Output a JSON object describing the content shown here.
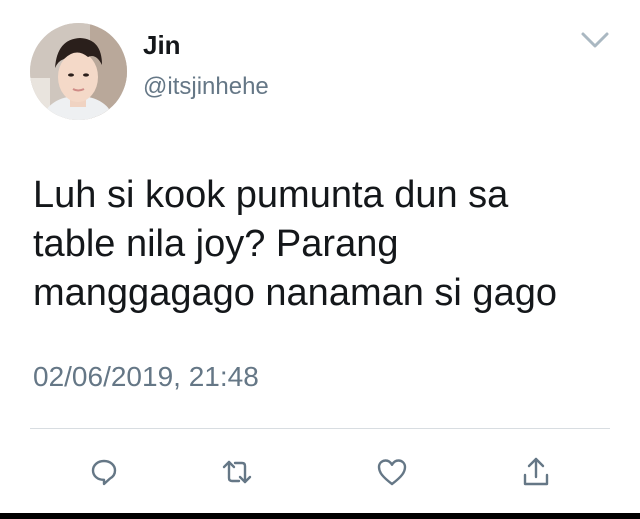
{
  "user": {
    "display_name": "Jin",
    "handle": "@itsjinhehe",
    "avatar": "profile-photo"
  },
  "tweet": {
    "lines": [
      "Luh si kook pumunta dun sa",
      "table nila joy? Parang",
      "manggagago nanaman si gago"
    ],
    "timestamp": "02/06/2019, 21:48"
  },
  "actions": [
    {
      "name": "reply",
      "icon": "speech-bubble-icon"
    },
    {
      "name": "retweet",
      "icon": "retweet-icon"
    },
    {
      "name": "like",
      "icon": "heart-icon"
    },
    {
      "name": "share",
      "icon": "share-icon"
    }
  ],
  "colors": {
    "text": "#14171a",
    "secondary": "#657786",
    "icon": "#657786",
    "divider": "#d8dde1",
    "caret": "#aab8c2"
  }
}
